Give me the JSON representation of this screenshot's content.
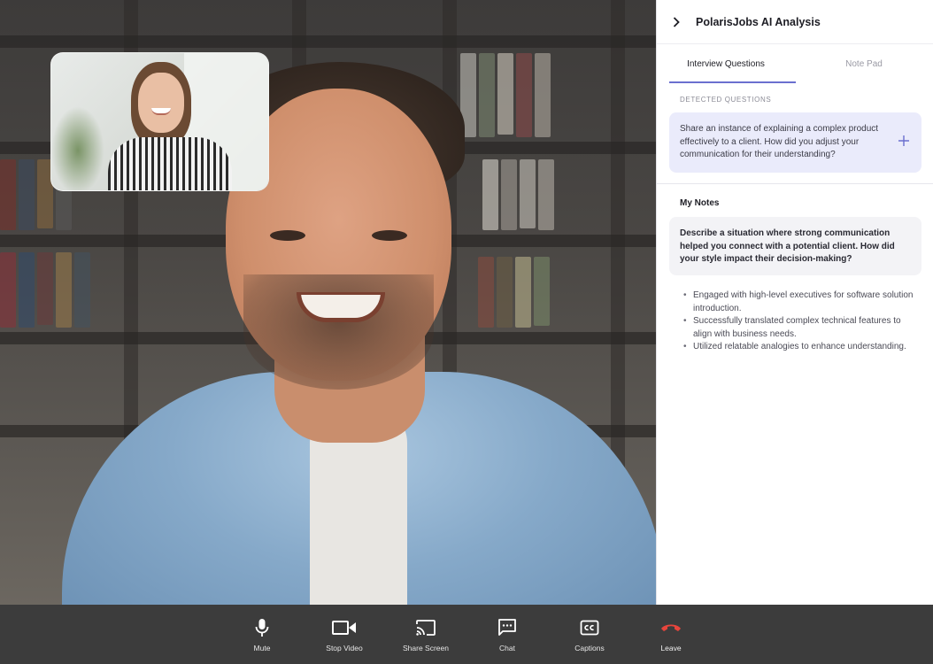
{
  "panel": {
    "title": "PolarisJobs AI Analysis",
    "tabs": [
      {
        "label": "Interview Questions",
        "active": true
      },
      {
        "label": "Note Pad",
        "active": false
      }
    ],
    "detected_label": "DETECTED QUESTIONS",
    "detected_question": "Share an instance of explaining a complex product effectively to a client. How did you adjust your communication for their understanding?",
    "notes_title": "My Notes",
    "notes_question": "Describe a situation where strong communication helped you connect with a potential client. How did your style impact their decision-making?",
    "notes_bullets": [
      "Engaged with high-level executives for software solution introduction.",
      "Successfully translated complex technical features to align with business needs.",
      "Utilized relatable analogies to enhance understanding."
    ]
  },
  "toolbar": {
    "items": [
      {
        "label": "Mute",
        "icon": "microphone-icon"
      },
      {
        "label": "Stop Video",
        "icon": "video-camera-icon"
      },
      {
        "label": "Share Screen",
        "icon": "cast-icon"
      },
      {
        "label": "Chat",
        "icon": "chat-icon"
      },
      {
        "label": "Captions",
        "icon": "captions-icon"
      },
      {
        "label": "Leave",
        "icon": "hang-up-icon"
      }
    ]
  },
  "colors": {
    "accent": "#6b6fcf",
    "question_card_bg": "#eaebfb",
    "toolbar_bg": "#3c3c3c",
    "leave_red": "#e8453c"
  }
}
